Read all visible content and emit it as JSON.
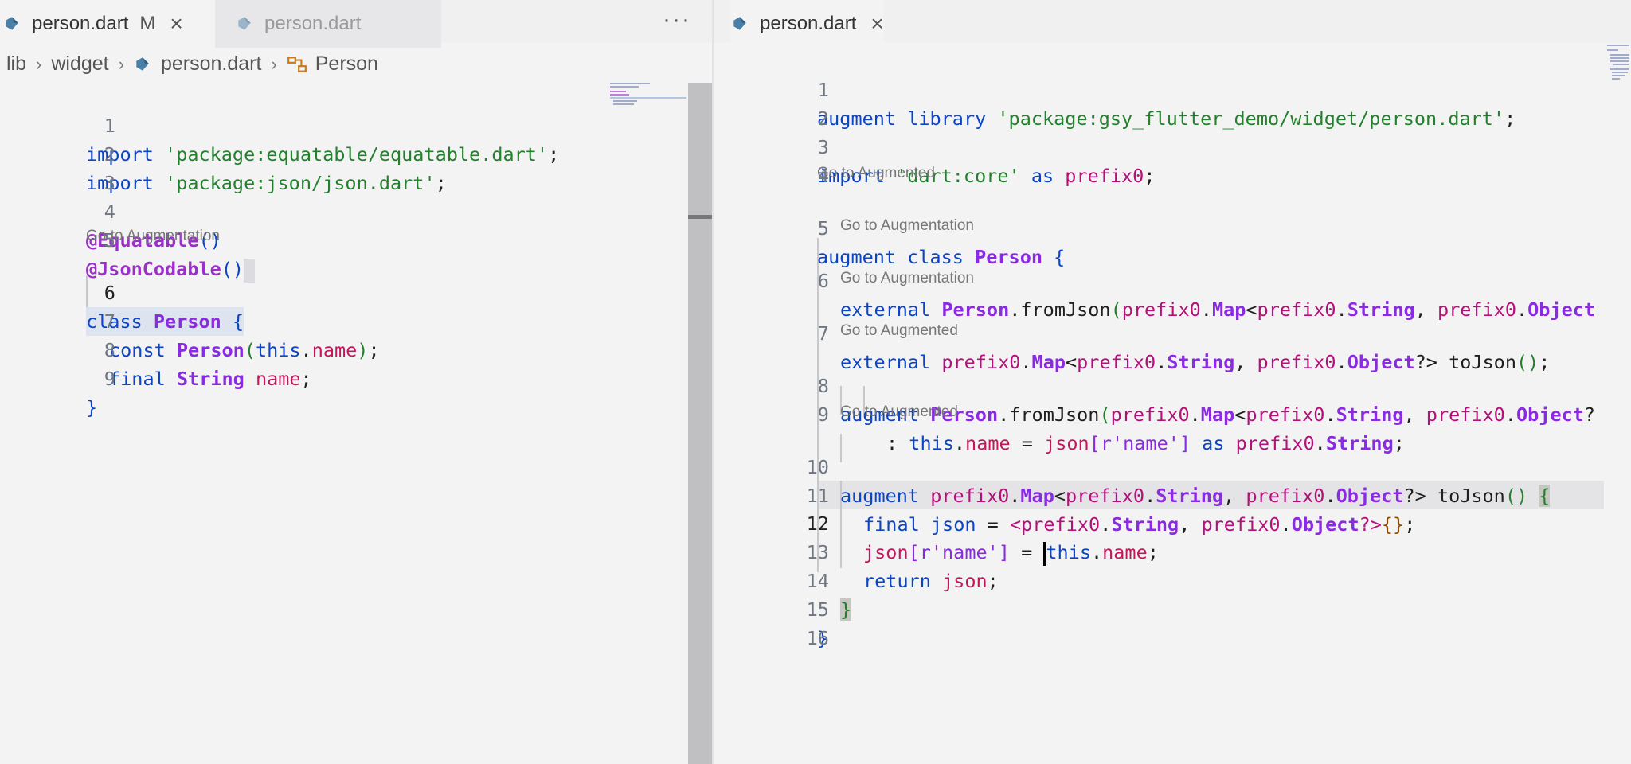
{
  "left_editor": {
    "tabs": [
      {
        "label": "person.dart",
        "modified": "M",
        "active": true
      },
      {
        "label": "person.dart",
        "active": false
      }
    ],
    "more_actions": "···",
    "breadcrumb": [
      "lib",
      "widget",
      "person.dart",
      "Person"
    ],
    "lens_go_to_augmentation": "Go to Augmentation",
    "line_numbers": [
      "1",
      "2",
      "3",
      "4",
      "5",
      "6",
      "7",
      "8",
      "9"
    ]
  },
  "right_editor": {
    "tab": {
      "label": "person.dart"
    },
    "lens_go_to_augmented": "Go to Augmented",
    "lens_go_to_augmentation": "Go to Augmentation",
    "line_numbers": [
      "1",
      "2",
      "3",
      "4",
      "5",
      "6",
      "7",
      "8",
      "9",
      "10",
      "11",
      "12",
      "13",
      "14",
      "15",
      "16"
    ]
  },
  "code_left": {
    "l1": {
      "kw": "import",
      "str": "'package:equatable/equatable.dart'",
      "end": ";"
    },
    "l2": {
      "kw": "import",
      "str": "'package:json/json.dart'",
      "end": ";"
    },
    "l4": {
      "ann": "@Equatable",
      "paren": "()"
    },
    "l5": {
      "ann": "@JsonCodable",
      "paren": "()"
    },
    "l6": {
      "kw": "class",
      "ty": "Person",
      "brace": "{"
    },
    "l7": {
      "kw": "const",
      "ty": "Person",
      "open": "(",
      "this": "this",
      "dot": ".",
      "field": "name",
      "close": ")",
      "end": ";"
    },
    "l8": {
      "kw": "final",
      "ty": "String",
      "field": "name",
      "end": ";"
    },
    "l9": {
      "brace": "}"
    }
  },
  "code_right": {
    "l1": {
      "kw1": "augment",
      "kw2": "library",
      "str": "'package:gsy_flutter_demo/widget/person.dart'",
      "end": ";"
    },
    "l3": {
      "kw": "import",
      "str": "'dart:core'",
      "kw2": "as",
      "prefix": "prefix0",
      "end": ";"
    },
    "l5": {
      "kw1": "augment",
      "kw2": "class",
      "ty": "Person",
      "brace": "{"
    },
    "l6": {
      "kw": "external",
      "ty": "Person",
      "dot": ".",
      "fn": "fromJson",
      "open": "(",
      "p1": "prefix0",
      "d1": ".",
      "t1": "Map",
      "lt": "<",
      "p2": "prefix0",
      "d2": ".",
      "t2": "String",
      "comma": ", ",
      "p3": "prefix0",
      "d3": ".",
      "t3": "Object"
    },
    "l7": {
      "kw": "external",
      "p1": "prefix0",
      "d1": ".",
      "t1": "Map",
      "lt": "<",
      "p2": "prefix0",
      "d2": ".",
      "t2": "String",
      "comma": ", ",
      "p3": "prefix0",
      "d3": ".",
      "t3": "Object",
      "q": "?>",
      "fn": " toJson",
      "paren": "()",
      "end": ";"
    },
    "l8": {
      "kw": "augment",
      "ty": "Person",
      "dot": ".",
      "fn": "fromJson",
      "open": "(",
      "p1": "prefix0",
      "d1": ".",
      "t1": "Map",
      "lt": "<",
      "p2": "prefix0",
      "d2": ".",
      "t2": "String",
      "comma": ", ",
      "p3": "prefix0",
      "d3": ".",
      "t3": "Object",
      "q": "?"
    },
    "l9": {
      "colon": ": ",
      "this": "this",
      "dot": ".",
      "field": "name",
      "eq": " = ",
      "json": "json",
      "idx": "[r'name']",
      "as": " as ",
      "p": "prefix0",
      "d": ".",
      "t": "String",
      "end": ";"
    },
    "l10": {
      "kw": "augment",
      "p1": "prefix0",
      "d1": ".",
      "t1": "Map",
      "lt": "<",
      "p2": "prefix0",
      "d2": ".",
      "t2": "String",
      "comma": ", ",
      "p3": "prefix0",
      "d3": ".",
      "t3": "Object",
      "q": "?>",
      "fn": " toJson",
      "paren": "()",
      "brace": "{"
    },
    "l11": {
      "kw": "final",
      "var": " json",
      "eq": " = ",
      "lt": "<",
      "p1": "prefix0",
      "d1": ".",
      "t1": "String",
      "comma": ", ",
      "p2": "prefix0",
      "d2": ".",
      "t2": "Object",
      "q": "?>",
      "braces": "{}",
      "end": ";"
    },
    "l12": {
      "json": "json",
      "idx": "[r'name']",
      "eq": " = ",
      "this": "this",
      "dot": ".",
      "field": "name",
      "end": ";"
    },
    "l13": {
      "kw": "return",
      "var": " json",
      "end": ";"
    },
    "l14": {
      "brace": "}"
    },
    "l15": {
      "brace": "}"
    }
  }
}
